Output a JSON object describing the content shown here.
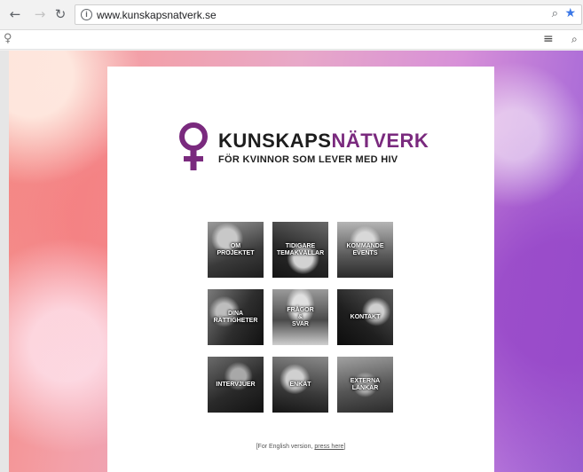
{
  "browser": {
    "url": "www.kunskapsnatverk.se"
  },
  "colors": {
    "brand_purple": "#7a2a7e",
    "brand_dark": "#1d1d1d",
    "star_blue": "#3b78e7"
  },
  "icons": {
    "back": "back-arrow-icon",
    "forward": "forward-arrow-icon",
    "reload": "reload-icon",
    "info": "info-icon",
    "zoom": "zoom-icon",
    "bookmark": "star-icon",
    "site": "venus-icon",
    "menu": "hamburger-menu-icon",
    "search": "search-icon"
  },
  "logo": {
    "word_part1": "KUNSKAPS",
    "word_part2": "NÄTVERK",
    "tagline": "FÖR KVINNOR SOM LEVER MED HIV"
  },
  "tiles": [
    {
      "label": "OM\nPROJEKTET"
    },
    {
      "label": "TIDIGARE\nTEMAKVÄLLAR"
    },
    {
      "label": "KOMMANDE\nEVENTS"
    },
    {
      "label": "DINA\nRÄTTIGHETER"
    },
    {
      "label": "FRÅGOR\n&\nSVAR"
    },
    {
      "label": "KONTAKT"
    },
    {
      "label": "INTERVJUER"
    },
    {
      "label": "ENKÄT"
    },
    {
      "label": "EXTERNA\nLÄNKAR"
    }
  ],
  "footer": {
    "prefix": "[For English version, ",
    "link": "press here",
    "suffix": "]"
  }
}
